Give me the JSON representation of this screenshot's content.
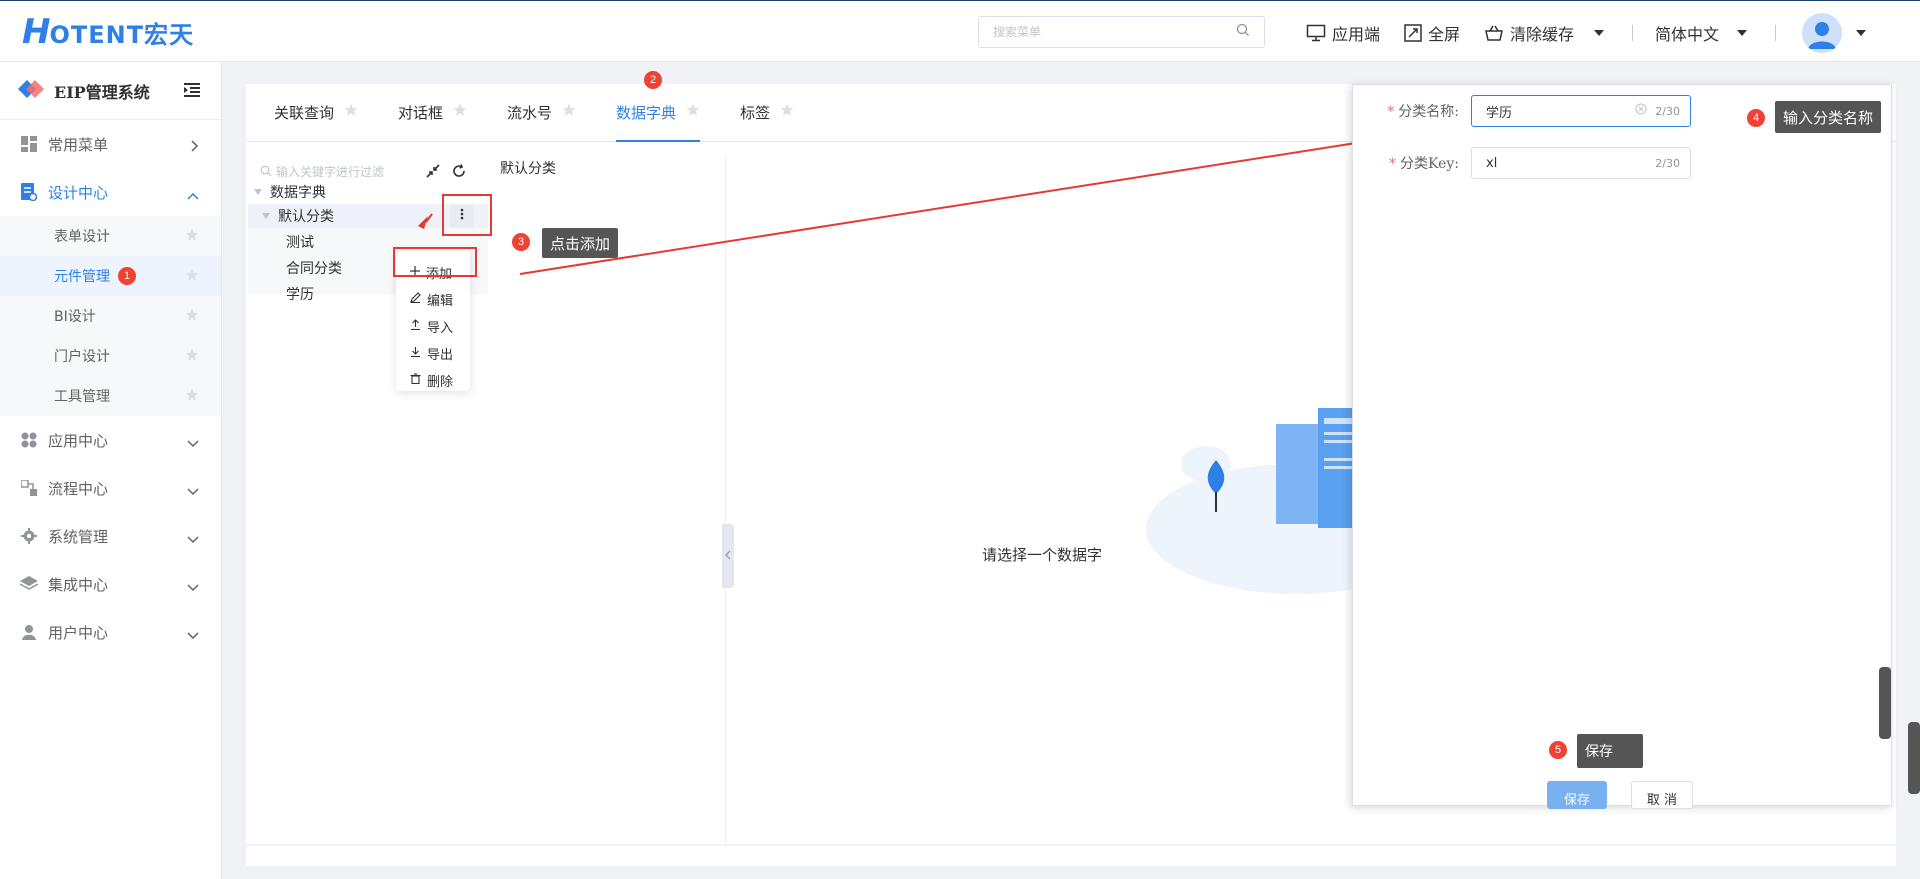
{
  "header": {
    "logo_mark": "H",
    "logo_text": "OTENT宏天",
    "search_placeholder": "搜索菜单",
    "tools": {
      "app": "应用端",
      "fullscreen": "全屏",
      "clear_cache": "清除缓存",
      "language": "简体中文"
    }
  },
  "sidebar": {
    "title": "EIP管理系统",
    "menus": [
      {
        "label": "常用菜单"
      },
      {
        "label": "设计中心"
      },
      {
        "label": "应用中心"
      },
      {
        "label": "流程中心"
      },
      {
        "label": "系统管理"
      },
      {
        "label": "集成中心"
      },
      {
        "label": "用户中心"
      }
    ],
    "submenu": [
      {
        "label": "表单设计"
      },
      {
        "label": "元件管理",
        "badge": "1"
      },
      {
        "label": "BI设计"
      },
      {
        "label": "门户设计"
      },
      {
        "label": "工具管理"
      }
    ]
  },
  "tabs": [
    {
      "label": "关联查询"
    },
    {
      "label": "对话框"
    },
    {
      "label": "流水号"
    },
    {
      "label": "数据字典",
      "badge": "2"
    },
    {
      "label": "标签"
    }
  ],
  "tree": {
    "filter_placeholder": "输入关键字进行过滤",
    "crumb": "默认分类",
    "root": "数据字典",
    "default_node": "默认分类",
    "children": [
      "测试",
      "合同分类",
      "学历"
    ]
  },
  "dropdown": {
    "items": [
      "添加",
      "编辑",
      "导入",
      "导出",
      "删除"
    ]
  },
  "annotations": {
    "step3_num": "3",
    "step3_text": "点击添加",
    "step4_num": "4",
    "step4_text": "输入分类名称",
    "step5_num": "5",
    "step5_text": "保存"
  },
  "empty_state": {
    "text": "请选择一个数据字"
  },
  "dialog": {
    "name_label": "分类名称:",
    "name_value": "学历",
    "name_count": "2/30",
    "key_label": "分类Key:",
    "key_value": "xl",
    "key_count": "2/30",
    "save_label": "保存",
    "cancel_label": "取 消"
  },
  "colors": {
    "primary": "#2f80e6",
    "badge": "#f04134",
    "annotation_red": "#e53935"
  }
}
